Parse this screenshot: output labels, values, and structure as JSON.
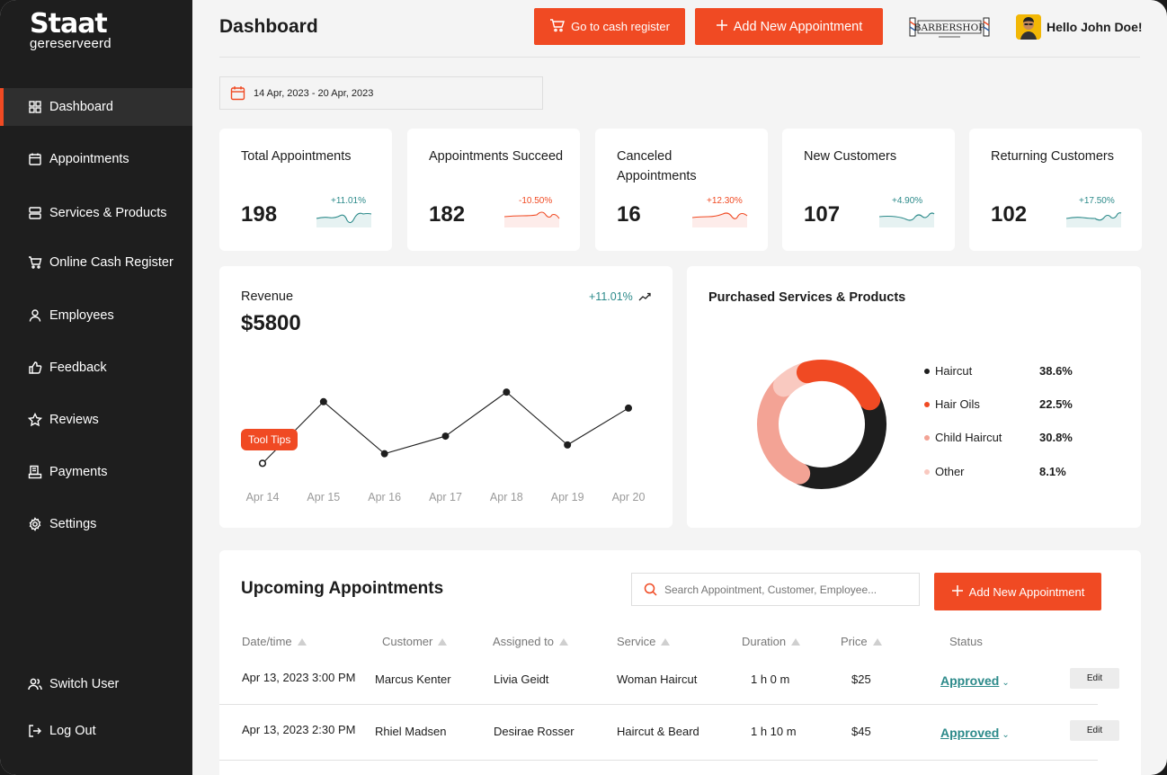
{
  "sidebar": {
    "logo_main": "Staat",
    "logo_sub": "gereserveerd",
    "items": [
      {
        "label": "Dashboard",
        "icon": "grid-icon"
      },
      {
        "label": "Appointments",
        "icon": "calendar-icon"
      },
      {
        "label": "Services & Products",
        "icon": "services-icon"
      },
      {
        "label": "Online Cash Register",
        "icon": "cart-icon"
      },
      {
        "label": "Employees",
        "icon": "user-icon"
      },
      {
        "label": "Feedback",
        "icon": "thumbs-up-icon"
      },
      {
        "label": "Reviews",
        "icon": "star-icon"
      },
      {
        "label": "Payments",
        "icon": "receipt-icon"
      },
      {
        "label": "Settings",
        "icon": "gear-icon"
      }
    ],
    "bottom": [
      {
        "label": "Switch User",
        "icon": "users-icon"
      },
      {
        "label": "Log Out",
        "icon": "logout-icon"
      }
    ]
  },
  "header": {
    "title": "Dashboard",
    "cash_register_label": "Go to cash register",
    "add_appointment_label": "Add New Appointment",
    "shop_logo_text": "BARBERSHOP",
    "greeting": "Hello John Doe!"
  },
  "date_range": "14 Apr, 2023 - 20 Apr, 2023",
  "stats": [
    {
      "title": "Total Appointments",
      "value": "198",
      "delta": "+11.01%",
      "trend": "up"
    },
    {
      "title": "Appointments Succeed",
      "value": "182",
      "delta": "-10.50%",
      "trend": "down"
    },
    {
      "title": "Canceled Appointments",
      "value": "16",
      "delta": "+12.30%",
      "trend": "down"
    },
    {
      "title": "New Customers",
      "value": "107",
      "delta": "+4.90%",
      "trend": "up"
    },
    {
      "title": "Returning Customers",
      "value": "102",
      "delta": "+17.50%",
      "trend": "up"
    }
  ],
  "revenue": {
    "title": "Revenue",
    "amount": "$5800",
    "delta": "+11.01%",
    "tooltip": "Tool Tips"
  },
  "chart_data": {
    "type": "line",
    "categories": [
      "Apr 14",
      "Apr 15",
      "Apr 16",
      "Apr 17",
      "Apr 18",
      "Apr 19",
      "Apr 20"
    ],
    "values": [
      3,
      80,
      15,
      37,
      92,
      26,
      72
    ],
    "title": "Revenue",
    "xlabel": "",
    "ylabel": "",
    "ylim": [
      0,
      100
    ]
  },
  "purchased": {
    "title": "Purchased Services & Products",
    "items": [
      {
        "label": "Haircut",
        "value": "38.6%",
        "pct": 38.6,
        "color": "#1e1e1e"
      },
      {
        "label": "Hair Oils",
        "value": "22.5%",
        "pct": 22.5,
        "color": "#f04a23"
      },
      {
        "label": "Child Haircut",
        "value": "30.8%",
        "pct": 30.8,
        "color": "#f3a395"
      },
      {
        "label": "Other",
        "value": "8.1%",
        "pct": 8.1,
        "color": "#f9c9c0"
      }
    ]
  },
  "upcoming": {
    "title": "Upcoming Appointments",
    "search_placeholder": "Search Appointment, Customer, Employee...",
    "add_label": "Add New Appointment",
    "columns": [
      "Date/time",
      "Customer",
      "Assigned to",
      "Service",
      "Duration",
      "Price",
      "Status"
    ],
    "rows": [
      {
        "datetime": "Apr 13, 2023 3:00 PM",
        "customer": "Marcus Kenter",
        "assigned": "Livia Geidt",
        "service": "Woman Haircut",
        "duration": "1 h 0 m",
        "price": "$25",
        "status": "Approved",
        "edit": "Edit"
      },
      {
        "datetime": "Apr 13, 2023 2:30 PM",
        "customer": "Rhiel Madsen",
        "assigned": "Desirae Rosser",
        "service": "Haircut & Beard",
        "duration": "1 h 10 m",
        "price": "$45",
        "status": "Approved",
        "edit": "Edit"
      }
    ]
  },
  "colors": {
    "accent": "#f04a23",
    "teal": "#2c8a8a",
    "sidebar": "#1e1e1e"
  }
}
